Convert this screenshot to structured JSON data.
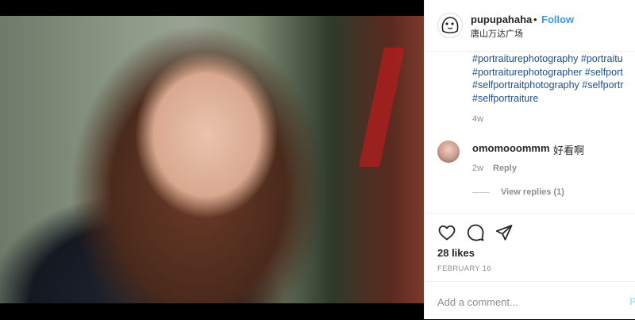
{
  "post": {
    "photo_icon": "portrait-photo",
    "header": {
      "username": "pupupahaha",
      "separator": "•",
      "follow_label": "Follow",
      "location": "唐山万达广场"
    },
    "caption": {
      "hashtags": [
        "#portraiturephotography #portraitu",
        "#portraiturephotographer #selfport",
        "#selfportraitphotography #selfportr",
        "#selfportraiture"
      ],
      "time": "4w"
    },
    "comment": {
      "username": "omomooommm",
      "text": "好看啊",
      "time": "2w",
      "reply_label": "Reply",
      "view_replies_label": "View replies (1)"
    },
    "actions": {
      "icons": [
        "heart-icon",
        "comment-icon",
        "share-icon"
      ],
      "likes": "28 likes",
      "date": "FEBRUARY 16"
    },
    "add_comment": {
      "placeholder": "Add a comment...",
      "post_label": "P"
    },
    "colors": {
      "link": "#3897f0",
      "hashtag": "#1f4f86",
      "muted": "#8e8e8e",
      "text": "#262626"
    }
  }
}
